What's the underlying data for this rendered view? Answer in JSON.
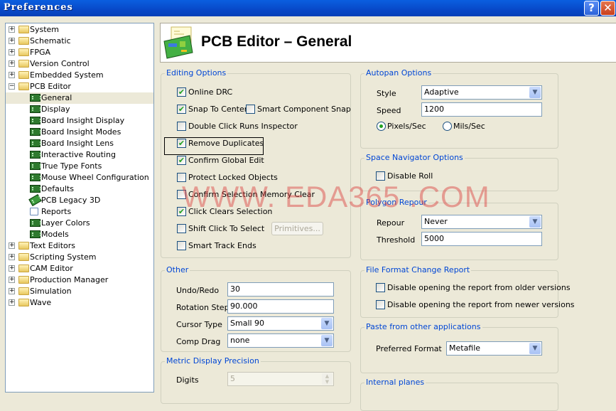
{
  "window": {
    "title": "Preferences",
    "help": "?",
    "close": "✕"
  },
  "tree": [
    {
      "label": "System",
      "level": 0,
      "expander": "+",
      "icon": "folder"
    },
    {
      "label": "Schematic",
      "level": 0,
      "expander": "+",
      "icon": "folder"
    },
    {
      "label": "FPGA",
      "level": 0,
      "expander": "+",
      "icon": "folder"
    },
    {
      "label": "Version Control",
      "level": 0,
      "expander": "+",
      "icon": "folder"
    },
    {
      "label": "Embedded System",
      "level": 0,
      "expander": "+",
      "icon": "folder"
    },
    {
      "label": "PCB Editor",
      "level": 0,
      "expander": "−",
      "icon": "folder"
    },
    {
      "label": "General",
      "level": 1,
      "icon": "pcb",
      "selected": true
    },
    {
      "label": "Display",
      "level": 1,
      "icon": "pcb"
    },
    {
      "label": "Board Insight Display",
      "level": 1,
      "icon": "pcb"
    },
    {
      "label": "Board Insight Modes",
      "level": 1,
      "icon": "pcb"
    },
    {
      "label": "Board Insight Lens",
      "level": 1,
      "icon": "pcb"
    },
    {
      "label": "Interactive Routing",
      "level": 1,
      "icon": "pcb"
    },
    {
      "label": "True Type Fonts",
      "level": 1,
      "icon": "pcb"
    },
    {
      "label": "Mouse Wheel Configuration",
      "level": 1,
      "icon": "pcb"
    },
    {
      "label": "Defaults",
      "level": 1,
      "icon": "pcb"
    },
    {
      "label": "PCB Legacy 3D",
      "level": 1,
      "icon": "pcb3d"
    },
    {
      "label": "Reports",
      "level": 1,
      "icon": "report"
    },
    {
      "label": "Layer Colors",
      "level": 1,
      "icon": "pcb"
    },
    {
      "label": "Models",
      "level": 1,
      "icon": "pcb"
    },
    {
      "label": "Text Editors",
      "level": 0,
      "expander": "+",
      "icon": "folder"
    },
    {
      "label": "Scripting System",
      "level": 0,
      "expander": "+",
      "icon": "folder"
    },
    {
      "label": "CAM Editor",
      "level": 0,
      "expander": "+",
      "icon": "folder"
    },
    {
      "label": "Production Manager",
      "level": 0,
      "expander": "+",
      "icon": "folder"
    },
    {
      "label": "Simulation",
      "level": 0,
      "expander": "+",
      "icon": "folder"
    },
    {
      "label": "Wave",
      "level": 0,
      "expander": "+",
      "icon": "folder"
    }
  ],
  "header": {
    "title": "PCB Editor – General"
  },
  "editing": {
    "title": "Editing Options",
    "options": [
      {
        "label": "Online DRC",
        "checked": true
      },
      {
        "label": "Snap To Center",
        "checked": true
      },
      {
        "label": "Smart Component Snap",
        "checked": false
      },
      {
        "label": "Double Click Runs Inspector",
        "checked": false
      },
      {
        "label": "Remove Duplicates",
        "checked": true
      },
      {
        "label": "Confirm Global Edit",
        "checked": true
      },
      {
        "label": "Protect Locked Objects",
        "checked": false
      },
      {
        "label": "Confirm Selection Memory Clear",
        "checked": false
      },
      {
        "label": "Click Clears Selection",
        "checked": true
      },
      {
        "label": "Shift Click To Select",
        "checked": false
      },
      {
        "label": "Smart Track Ends",
        "checked": false
      }
    ],
    "primitives": "Primitives..."
  },
  "other": {
    "title": "Other",
    "undo_label": "Undo/Redo",
    "undo": "30",
    "rot_label": "Rotation Step",
    "rot": "90.000",
    "cursor_label": "Cursor Type",
    "cursor": "Small 90",
    "drag_label": "Comp Drag",
    "drag": "none"
  },
  "metric": {
    "title": "Metric Display Precision",
    "digits_label": "Digits",
    "digits": "5"
  },
  "autopan": {
    "title": "Autopan Options",
    "style_label": "Style",
    "style": "Adaptive",
    "speed_label": "Speed",
    "speed": "1200",
    "unit_pixels": "Pixels/Sec",
    "unit_mils": "Mils/Sec",
    "selected_unit": "Pixels/Sec"
  },
  "spacenav": {
    "title": "Space Navigator Options",
    "disable_roll": "Disable Roll",
    "disable_roll_checked": false
  },
  "polygon": {
    "title": "Polygon Repour",
    "repour_label": "Repour",
    "repour": "Never",
    "threshold_label": "Threshold",
    "threshold": "5000"
  },
  "fileformat": {
    "title": "File Format Change Report",
    "older": "Disable opening the report from older versions",
    "newer": "Disable opening the report from newer versions"
  },
  "paste": {
    "title": "Paste from other applications",
    "format_label": "Preferred Format",
    "format": "Metafile"
  },
  "internal": {
    "title": "Internal planes"
  },
  "watermark": "WWW. EDA365 .COM",
  "check_glyph": "✔"
}
